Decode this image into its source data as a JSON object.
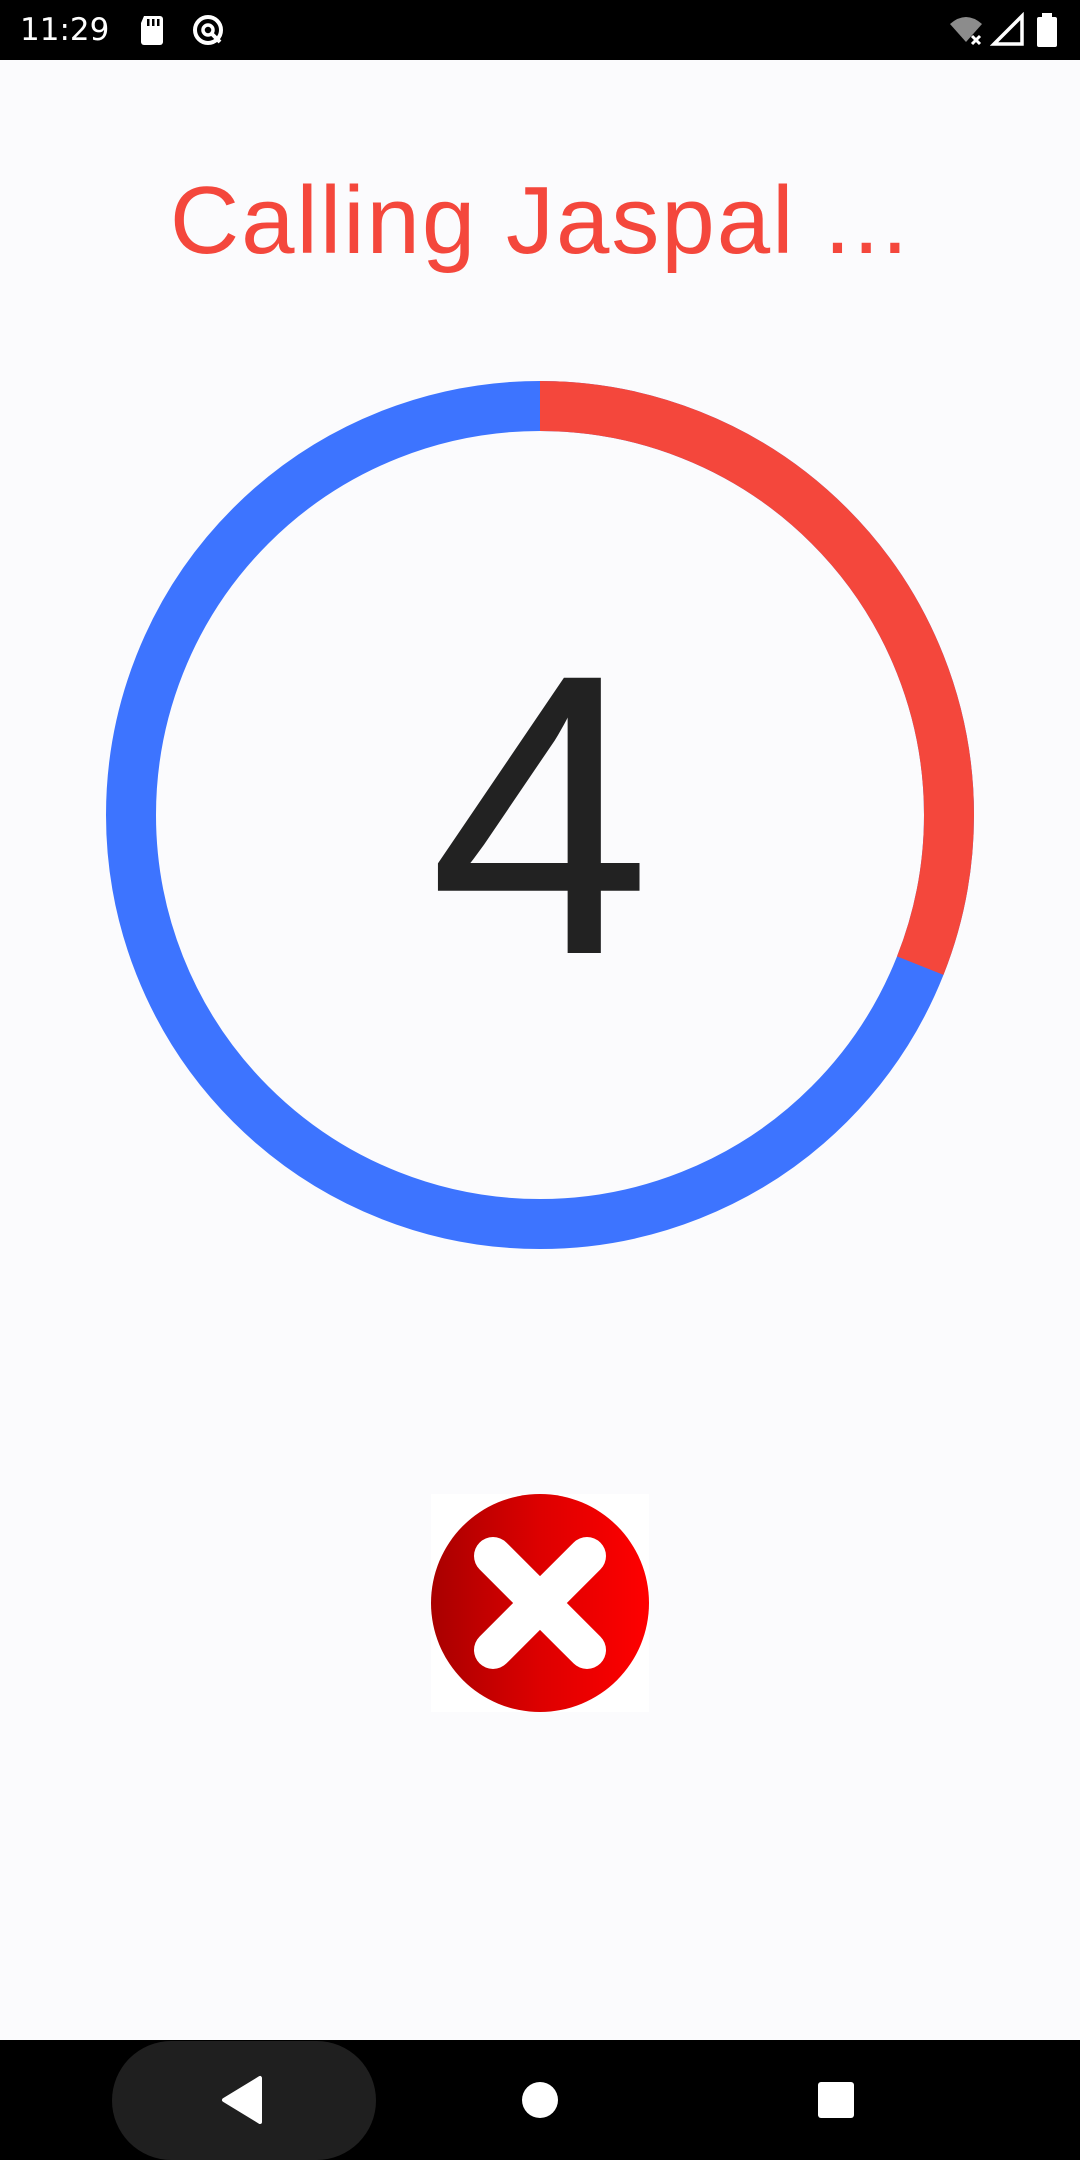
{
  "status_bar": {
    "time": "11:29",
    "icons": [
      "sd-card-icon",
      "data-saver-icon",
      "wifi-off-icon",
      "signal-icon",
      "battery-icon"
    ]
  },
  "call": {
    "title": "Calling Jaspal ...",
    "countdown": "4",
    "progress_fraction": 0.31
  },
  "colors": {
    "accent_red": "#F4473C",
    "ring_blue": "#3D74FF",
    "background": "#FBFBFD",
    "number": "#222222",
    "cancel_red": "#E60000"
  },
  "cancel": {
    "icon": "close-circle-icon"
  },
  "nav": {
    "icons": [
      "back-icon",
      "home-icon",
      "recents-icon"
    ]
  }
}
